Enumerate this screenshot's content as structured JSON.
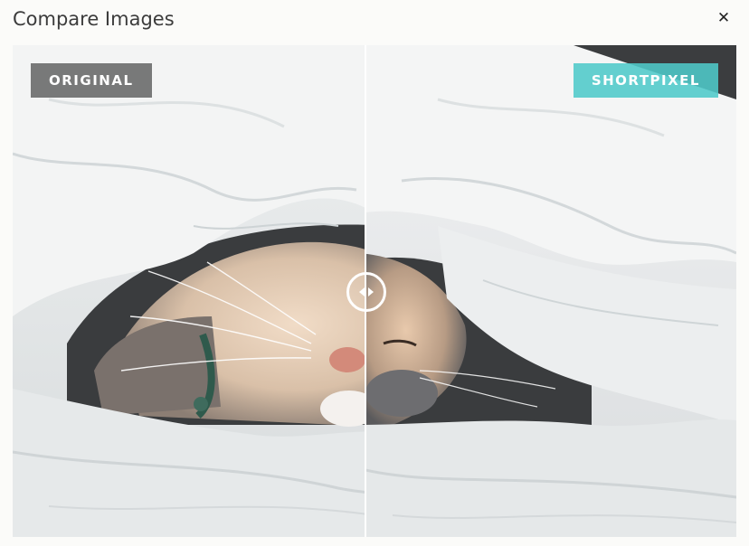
{
  "dialog": {
    "title": "Compare Images",
    "close_icon": "close-icon",
    "close_glyph": "✕"
  },
  "comparison": {
    "left_label": "ORIGINAL",
    "right_label": "SHORTPIXEL",
    "handle_icon": "compare-arrows-icon",
    "image_subject": "kitten-under-blanket"
  },
  "colors": {
    "original_label_bg": "#6e6e6e",
    "shortpixel_label_bg": "#4ec9c9",
    "divider": "#ffffff"
  }
}
